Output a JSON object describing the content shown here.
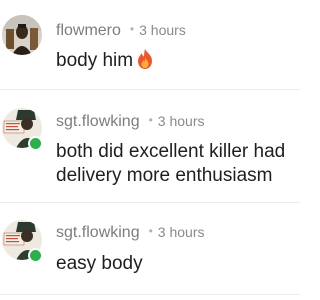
{
  "comments": [
    {
      "username": "flowmero",
      "separator": "•",
      "time": "3 hours",
      "text": "body him",
      "emoji": "fire-icon",
      "avatar": "user-photo-avatar",
      "online": false
    },
    {
      "username": "sgt.flowking",
      "separator": "•",
      "time": "3 hours",
      "text": "both did excellent killer had delivery more enthusiasm",
      "avatar": "user-photo-avatar",
      "online": true
    },
    {
      "username": "sgt.flowking",
      "separator": "•",
      "time": "3 hours",
      "text": "easy body",
      "avatar": "user-photo-avatar",
      "online": true
    }
  ],
  "colors": {
    "online": "#2bb14a",
    "flame": "#f0562a",
    "meta_text": "#8a8a8a",
    "body_text": "#1f1f1f"
  }
}
